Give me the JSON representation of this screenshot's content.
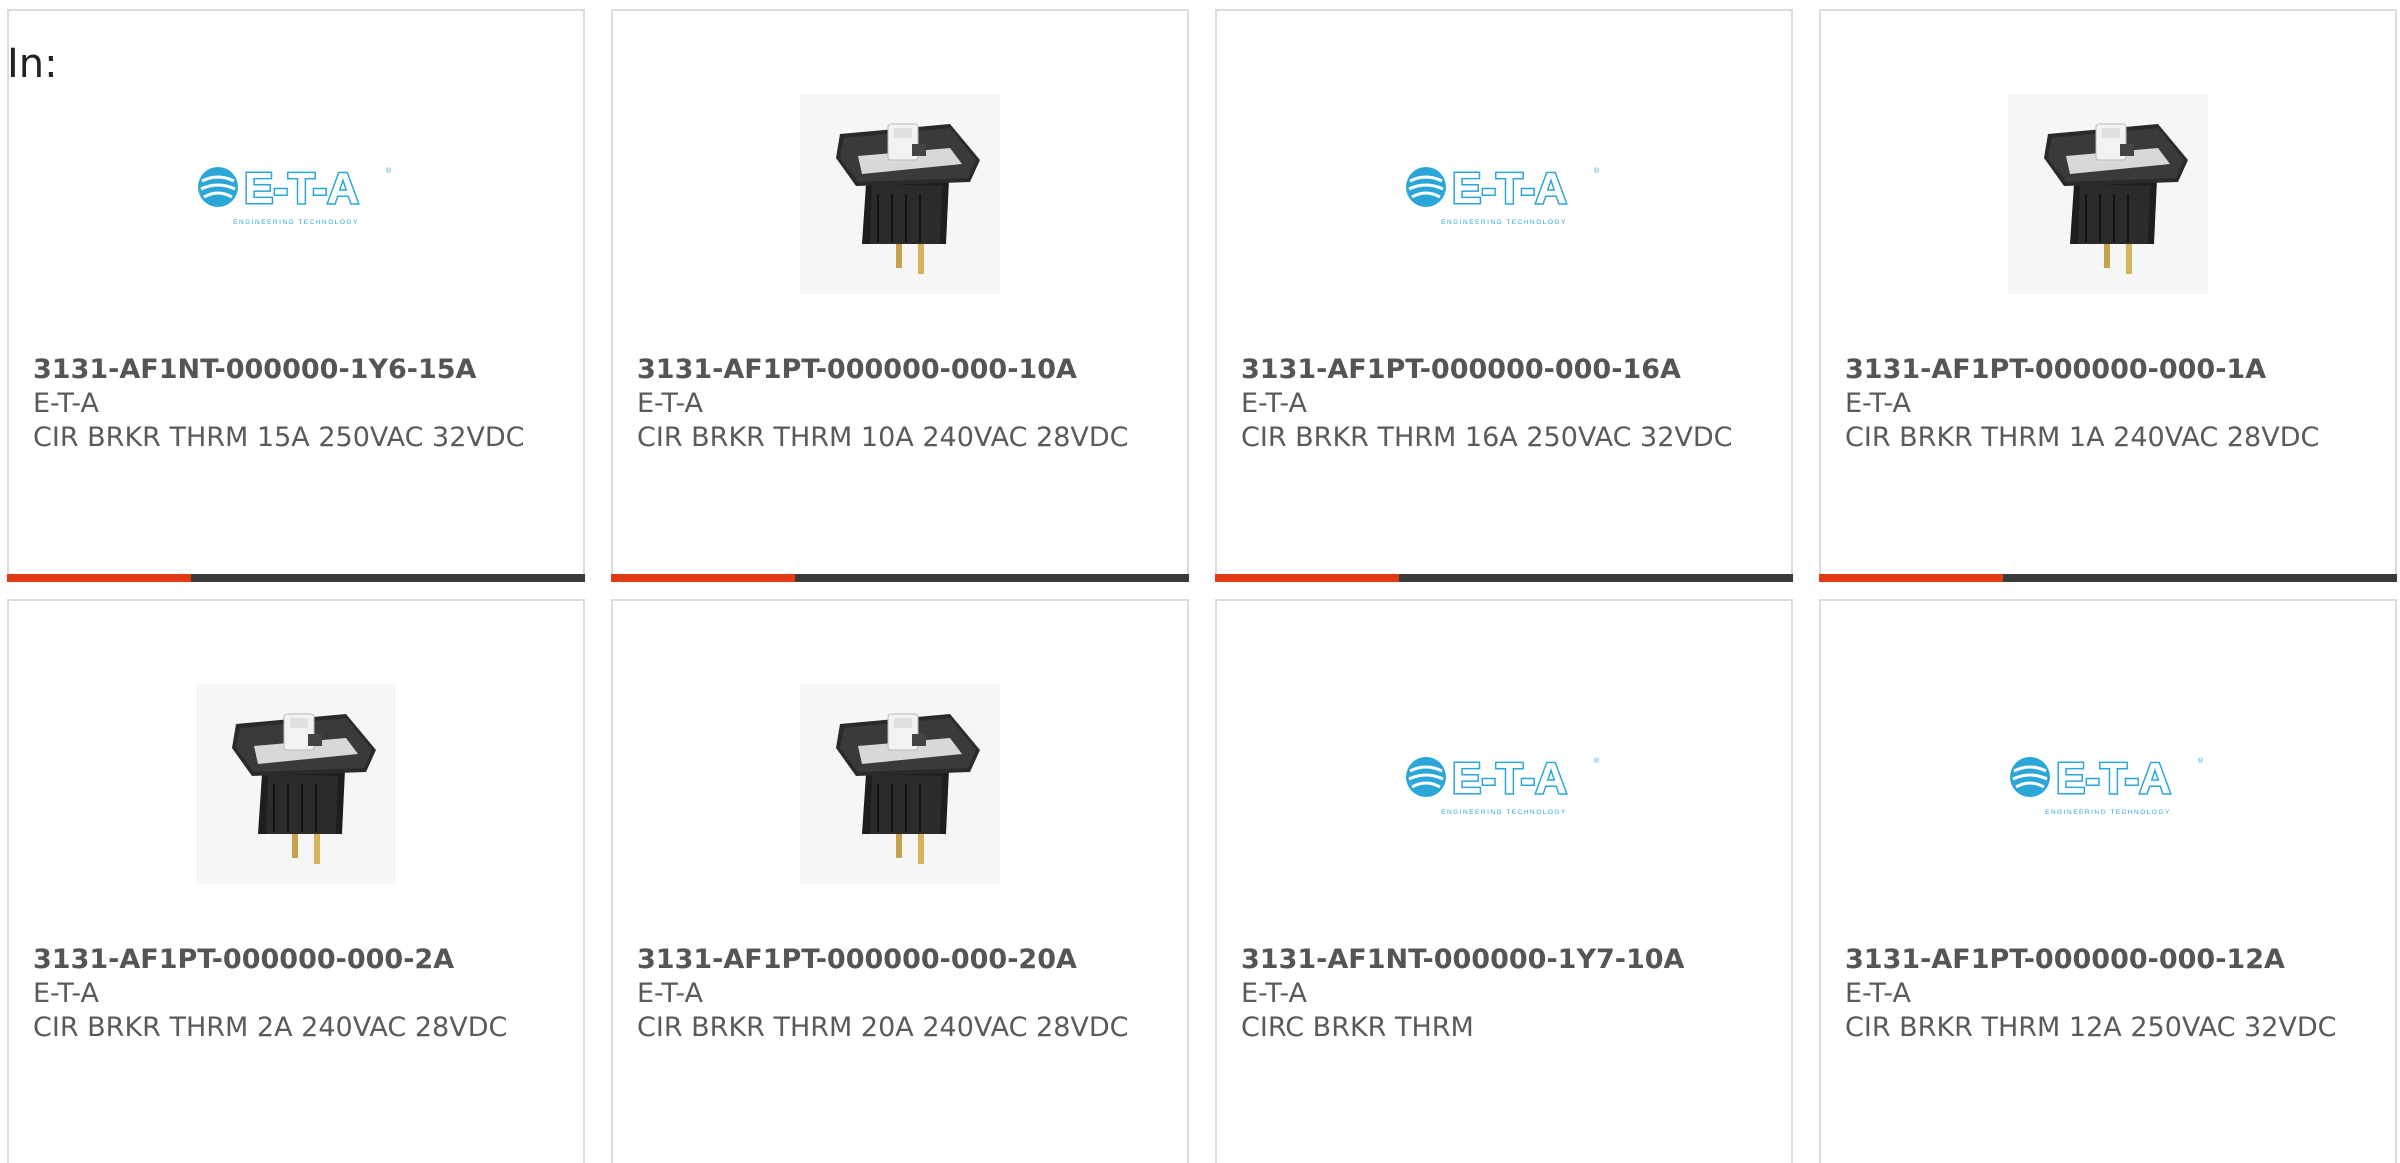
{
  "heading": "In:",
  "products": [
    {
      "part_number": "3131-AF1NT-000000-1Y6-15A",
      "manufacturer": "E-T-A",
      "description": "CIR BRKR THRM 15A 250VAC 32VDC",
      "image": "eta-logo"
    },
    {
      "part_number": "3131-AF1PT-000000-000-10A",
      "manufacturer": "E-T-A",
      "description": "CIR BRKR THRM 10A 240VAC 28VDC",
      "image": "rocker-switch"
    },
    {
      "part_number": "3131-AF1PT-000000-000-16A",
      "manufacturer": "E-T-A",
      "description": "CIR BRKR THRM 16A 250VAC 32VDC",
      "image": "eta-logo"
    },
    {
      "part_number": "3131-AF1PT-000000-000-1A",
      "manufacturer": "E-T-A",
      "description": "CIR BRKR THRM 1A 240VAC 28VDC",
      "image": "rocker-switch"
    },
    {
      "part_number": "3131-AF1PT-000000-000-2A",
      "manufacturer": "E-T-A",
      "description": "CIR BRKR THRM 2A 240VAC 28VDC",
      "image": "rocker-switch"
    },
    {
      "part_number": "3131-AF1PT-000000-000-20A",
      "manufacturer": "E-T-A",
      "description": "CIR BRKR THRM 20A 240VAC 28VDC",
      "image": "rocker-switch"
    },
    {
      "part_number": "3131-AF1NT-000000-1Y7-10A",
      "manufacturer": "E-T-A",
      "description": "CIRC BRKR THRM",
      "image": "eta-logo"
    },
    {
      "part_number": "3131-AF1PT-000000-000-12A",
      "manufacturer": "E-T-A",
      "description": "CIR BRKR THRM 12A 250VAC 32VDC",
      "image": "eta-logo"
    }
  ],
  "logo": {
    "text": "E-T-A",
    "tagline": "ENGINEERING TECHNOLOGY",
    "color": "#2aa6d9"
  },
  "colors": {
    "accent": "#e23a12",
    "bar": "#3a3a3a",
    "border": "#dcdcdc",
    "text": "#5a5a5a"
  }
}
